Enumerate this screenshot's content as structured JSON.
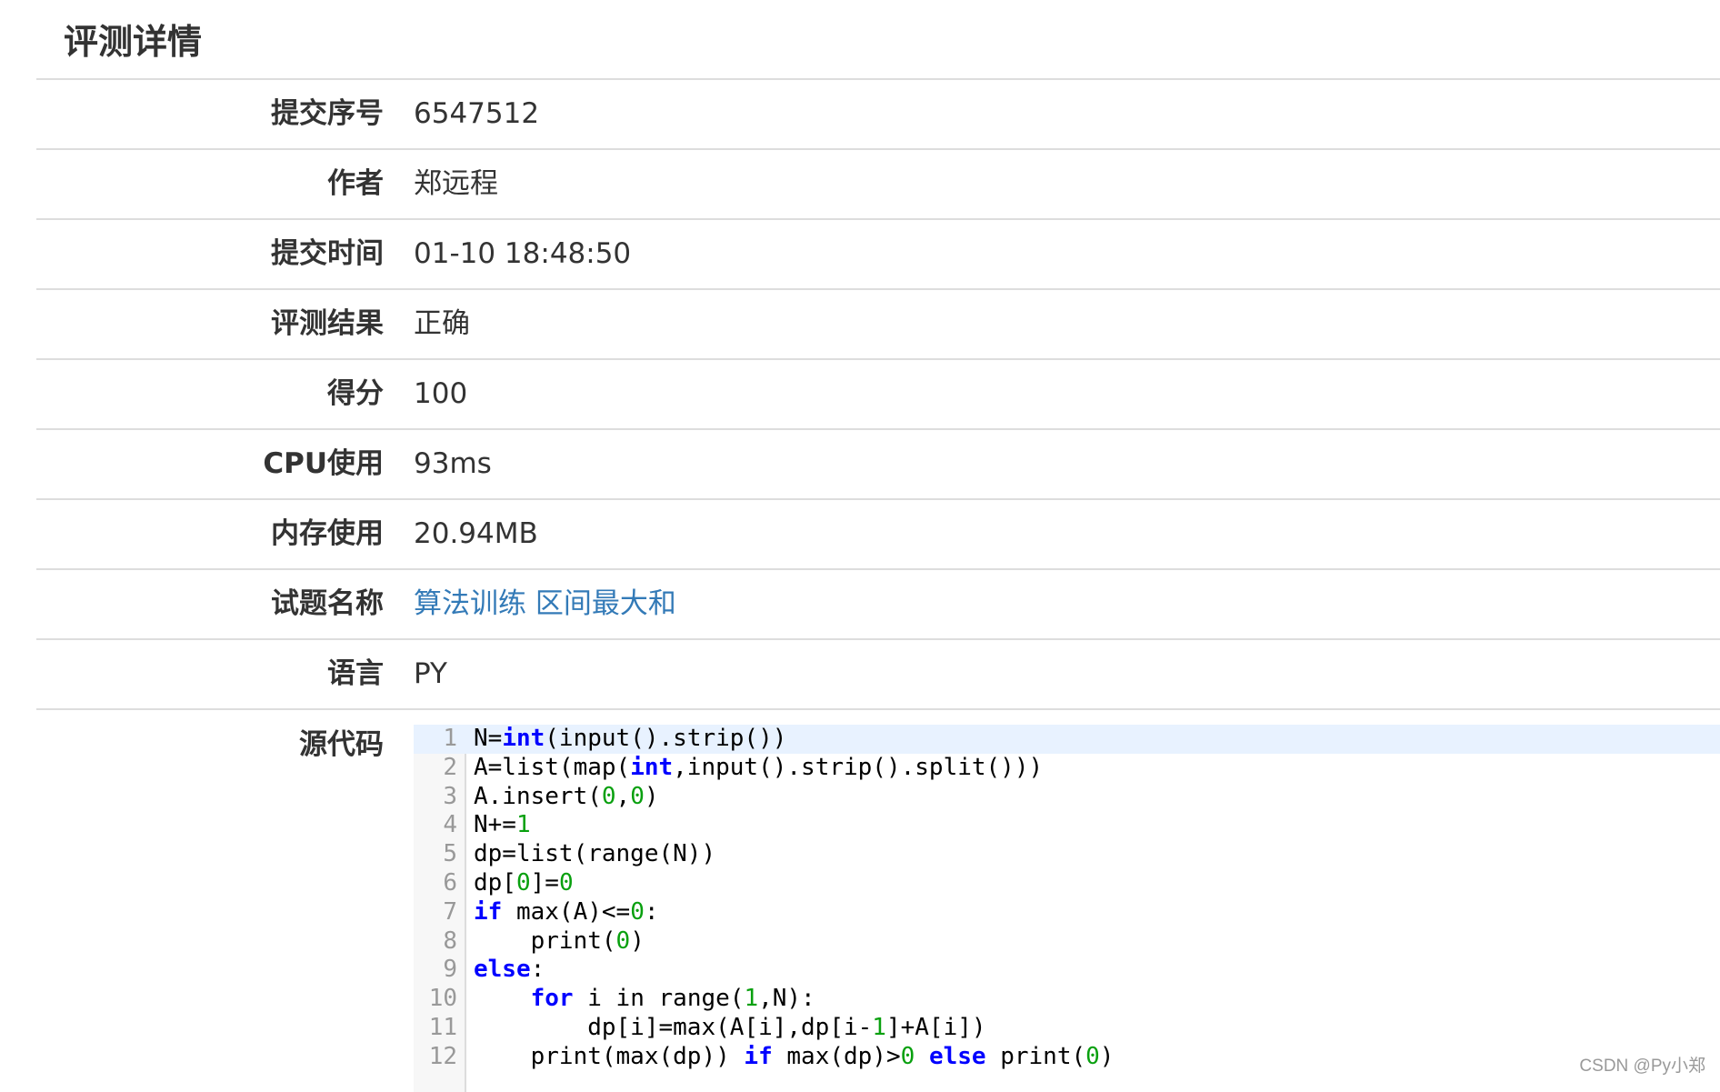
{
  "page": {
    "title": "评测详情"
  },
  "details": [
    {
      "label": "提交序号",
      "value": "6547512",
      "is_link": false
    },
    {
      "label": "作者",
      "value": "郑远程",
      "is_link": false
    },
    {
      "label": "提交时间",
      "value": "01-10 18:48:50",
      "is_link": false
    },
    {
      "label": "评测结果",
      "value": "正确",
      "is_link": false
    },
    {
      "label": "得分",
      "value": "100",
      "is_link": false
    },
    {
      "label": "CPU使用",
      "value": "93ms",
      "is_link": false
    },
    {
      "label": "内存使用",
      "value": "20.94MB",
      "is_link": false
    },
    {
      "label": "试题名称",
      "value": "算法训练 区间最大和",
      "is_link": true
    },
    {
      "label": "语言",
      "value": "PY",
      "is_link": false
    }
  ],
  "source": {
    "label": "源代码",
    "active_line": 1,
    "lines": [
      {
        "n": "1",
        "tokens": [
          [
            "N=",
            "t"
          ],
          [
            "int",
            "kw"
          ],
          [
            "(input().strip())",
            "t"
          ]
        ]
      },
      {
        "n": "2",
        "tokens": [
          [
            "A=list(map(",
            "t"
          ],
          [
            "int",
            "kw"
          ],
          [
            ",input().strip().split()))",
            "t"
          ]
        ]
      },
      {
        "n": "3",
        "tokens": [
          [
            "A.insert(",
            "t"
          ],
          [
            "0",
            "num"
          ],
          [
            ",",
            "t"
          ],
          [
            "0",
            "num"
          ],
          [
            ")",
            "t"
          ]
        ]
      },
      {
        "n": "4",
        "tokens": [
          [
            "N+=",
            "t"
          ],
          [
            "1",
            "num"
          ]
        ]
      },
      {
        "n": "5",
        "tokens": [
          [
            "dp=list(range(N))",
            "t"
          ]
        ]
      },
      {
        "n": "6",
        "tokens": [
          [
            "dp[",
            "t"
          ],
          [
            "0",
            "num"
          ],
          [
            "]=",
            "t"
          ],
          [
            "0",
            "num"
          ]
        ]
      },
      {
        "n": "7",
        "tokens": [
          [
            "if",
            "kw"
          ],
          [
            " max(A)<=",
            "t"
          ],
          [
            "0",
            "num"
          ],
          [
            ":",
            "t"
          ]
        ]
      },
      {
        "n": "8",
        "tokens": [
          [
            "    print(",
            "t"
          ],
          [
            "0",
            "num"
          ],
          [
            ")",
            "t"
          ]
        ]
      },
      {
        "n": "9",
        "tokens": [
          [
            "else",
            "kw"
          ],
          [
            ":",
            "t"
          ]
        ]
      },
      {
        "n": "10",
        "tokens": [
          [
            "    ",
            "t"
          ],
          [
            "for",
            "kw"
          ],
          [
            " i in range(",
            "t"
          ],
          [
            "1",
            "num"
          ],
          [
            ",N):",
            "t"
          ]
        ]
      },
      {
        "n": "11",
        "tokens": [
          [
            "        dp[i]=max(A[i],dp[i-",
            "t"
          ],
          [
            "1",
            "num"
          ],
          [
            "]+A[i])",
            "t"
          ]
        ]
      },
      {
        "n": "12",
        "tokens": [
          [
            "    print(max(dp)) ",
            "t"
          ],
          [
            "if",
            "kw"
          ],
          [
            " max(dp)>",
            "t"
          ],
          [
            "0",
            "num"
          ],
          [
            " ",
            "t"
          ],
          [
            "else",
            "kw"
          ],
          [
            " print(",
            "t"
          ],
          [
            "0",
            "num"
          ],
          [
            ")",
            "t"
          ]
        ]
      }
    ]
  },
  "watermark": "CSDN @Py小郑",
  "colors": {
    "link": "#337ab7",
    "keyword": "#0000ff",
    "number": "#09a00f",
    "active_line_bg": "#e8f2ff"
  }
}
